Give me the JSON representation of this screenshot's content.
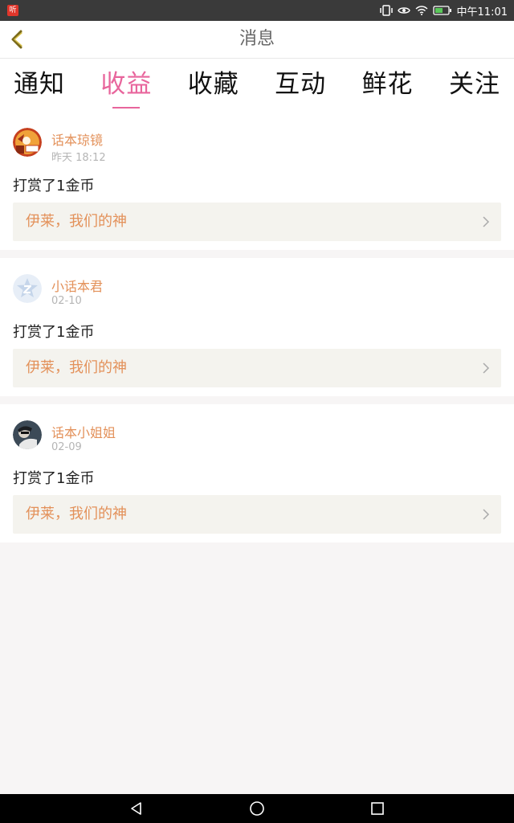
{
  "status_bar": {
    "app_icon_text": "听",
    "time": "中午11:01"
  },
  "header": {
    "title": "消息"
  },
  "tabs": [
    {
      "label": "通知",
      "active": false
    },
    {
      "label": "收益",
      "active": true
    },
    {
      "label": "收藏",
      "active": false
    },
    {
      "label": "互动",
      "active": false
    },
    {
      "label": "鲜花",
      "active": false
    },
    {
      "label": "关注",
      "active": false
    }
  ],
  "messages": [
    {
      "user": "话本琼镜",
      "time": "昨天 18:12",
      "text": "打赏了1金币",
      "link": "伊莱，我们的神"
    },
    {
      "user": "小话本君",
      "time": "02-10",
      "text": "打赏了1金币",
      "link": "伊莱，我们的神"
    },
    {
      "user": "话本小姐姐",
      "time": "02-09",
      "text": "打赏了1金币",
      "link": "伊莱，我们的神"
    }
  ],
  "colors": {
    "accent_pink": "#e8659c",
    "name_orange": "#e3915a",
    "link_bg": "#f4f3ee"
  }
}
